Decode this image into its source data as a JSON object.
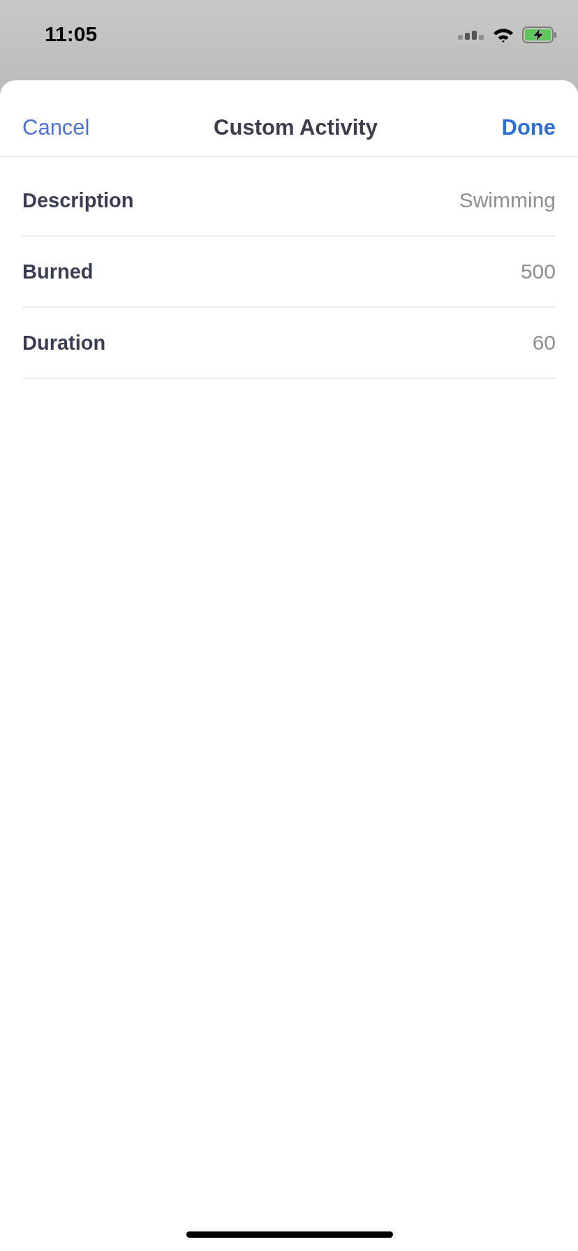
{
  "status_bar": {
    "time": "11:05"
  },
  "nav": {
    "cancel": "Cancel",
    "title": "Custom Activity",
    "done": "Done"
  },
  "fields": [
    {
      "label": "Description",
      "value": "Swimming"
    },
    {
      "label": "Burned",
      "value": "500"
    },
    {
      "label": "Duration",
      "value": "60"
    }
  ]
}
